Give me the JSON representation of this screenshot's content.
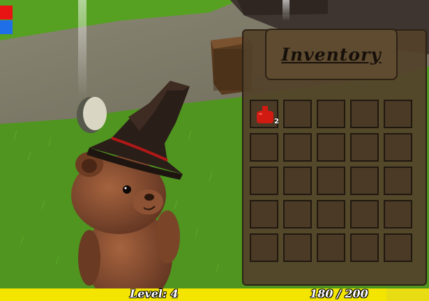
{
  "hud": {
    "health_color": "#e81414",
    "mana_color": "#1f6fe8"
  },
  "inventory": {
    "title": "Inventory",
    "columns": 5,
    "rows": 5,
    "slots": [
      {
        "item": "red-potion",
        "icon": "potion-icon",
        "color": "#d11a12",
        "count": "2"
      },
      {},
      {},
      {},
      {},
      {},
      {},
      {},
      {},
      {},
      {},
      {},
      {},
      {},
      {},
      {},
      {},
      {},
      {},
      {},
      {},
      {},
      {},
      {},
      {}
    ]
  },
  "status_bar": {
    "level_text": "Level: 4",
    "xp_text": "180 / 200",
    "xp_current": 180,
    "xp_max": 200,
    "bar_color": "#f4e500"
  },
  "scene": {
    "character": "bear-in-witch-hat",
    "objects": [
      "treasure-chest",
      "coin",
      "light-beam"
    ]
  }
}
